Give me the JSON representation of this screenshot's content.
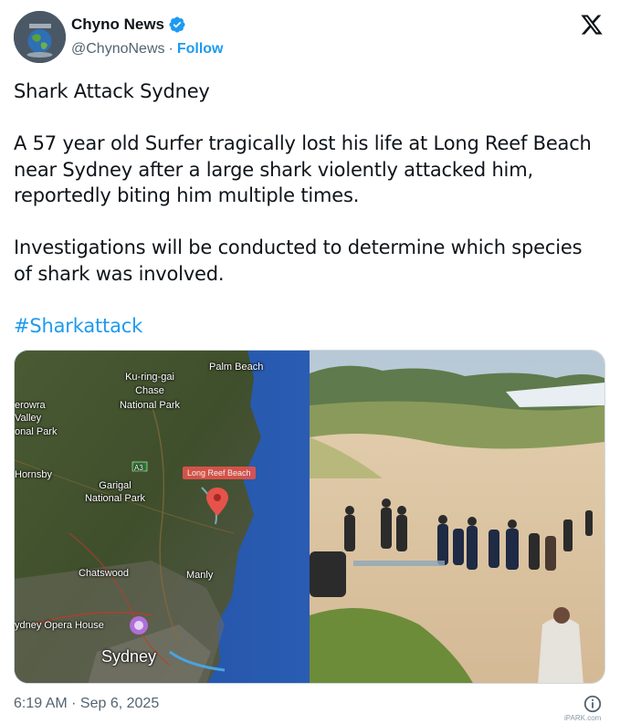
{
  "author": {
    "name": "Chyno News",
    "handle": "@ChynoNews",
    "separator": "·",
    "follow_label": "Follow",
    "verified": true,
    "avatar_icon": "globe-avatar-icon"
  },
  "tweet": {
    "title": "Shark Attack Sydney",
    "paragraph1": "A 57 year old Surfer tragically lost his life at Long Reef Beach near Sydney after a large shark violently attacked him, reportedly biting him multiple times.",
    "paragraph2": "Investigations will be conducted to determine which species of shark was involved.",
    "hashtag": "#Sharkattack"
  },
  "media": {
    "map_labels": {
      "palm_beach": "Palm Beach",
      "kuringgai": "Ku-ring-gai",
      "chase": "Chase",
      "national_park": "National Park",
      "berowra": "erowra",
      "valley": "Valley",
      "onal_park": "onal Park",
      "hornsby": "Hornsby",
      "a3": "A3",
      "garigal": "Garigal",
      "garigal_np": "National Park",
      "long_reef": "Long Reef Beach",
      "chatswood": "Chatswood",
      "manly": "Manly",
      "opera_house": "ydney Opera House",
      "sydney": "Sydney"
    }
  },
  "footer": {
    "timestamp": "6:19 AM · Sep 6, 2025",
    "watermark": "iPARK.com"
  },
  "colors": {
    "accent": "#1d9bf0",
    "text": "#0f1419",
    "secondary": "#536471",
    "pin": "#e5534b"
  }
}
